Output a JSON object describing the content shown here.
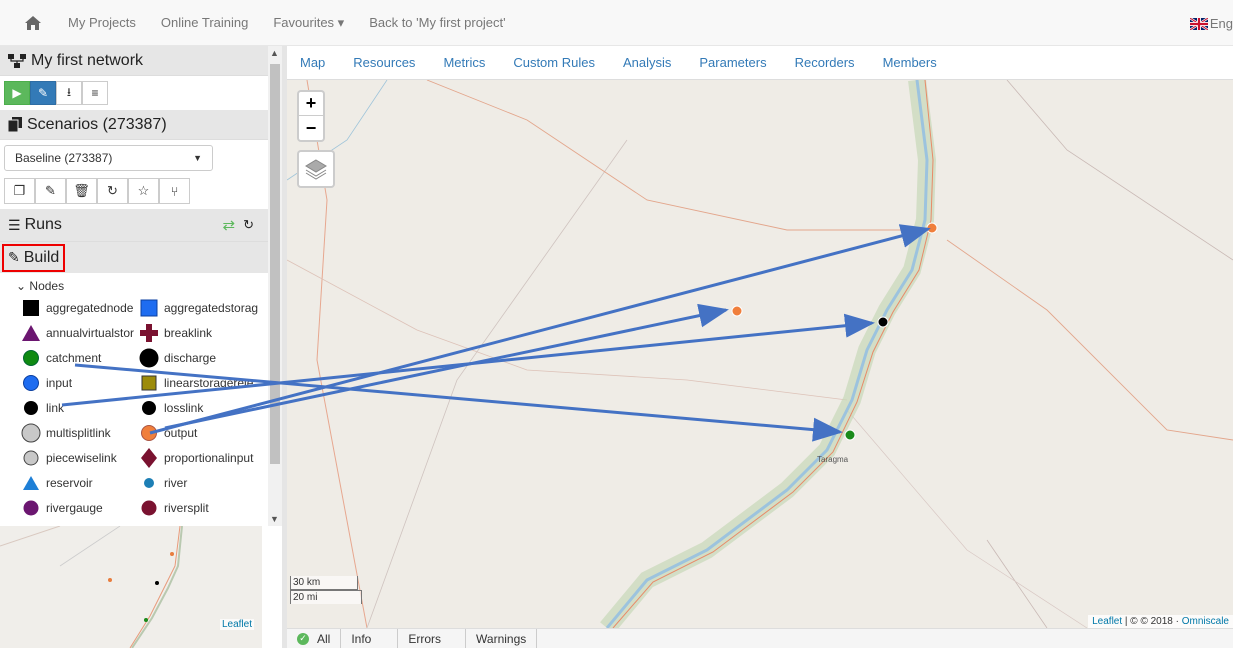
{
  "topnav": {
    "links": [
      "My Projects",
      "Online Training",
      "Favourites ▾",
      "Back to 'My first project'"
    ],
    "language": "Eng"
  },
  "network": {
    "title": "My first network",
    "buttons": [
      "run",
      "edit",
      "download",
      "settings"
    ]
  },
  "scenarios": {
    "title": "Scenarios (273387)",
    "selected": "Baseline (273387)",
    "buttons": [
      "copy",
      "edit",
      "delete",
      "refresh",
      "favourite",
      "branch"
    ]
  },
  "runs": {
    "title": "Runs"
  },
  "build": {
    "title": "Build",
    "nodes_title": "Nodes",
    "nodes": [
      {
        "label": "aggregatednode",
        "shape": "black-square"
      },
      {
        "label": "aggregatedstorag",
        "shape": "blue-square"
      },
      {
        "label": "annualvirtualstor",
        "shape": "purple-triangle"
      },
      {
        "label": "breaklink",
        "shape": "maroon-cross"
      },
      {
        "label": "catchment",
        "shape": "green-circle"
      },
      {
        "label": "discharge",
        "shape": "black-circle-large"
      },
      {
        "label": "input",
        "shape": "blue-circle"
      },
      {
        "label": "linearstoragerele",
        "shape": "olive-square"
      },
      {
        "label": "link",
        "shape": "black-circle"
      },
      {
        "label": "losslink",
        "shape": "black-circle"
      },
      {
        "label": "multisplitlink",
        "shape": "grey-circle-large"
      },
      {
        "label": "output",
        "shape": "orange-circle"
      },
      {
        "label": "piecewiselink",
        "shape": "grey-circle"
      },
      {
        "label": "proportionalinput",
        "shape": "maroon-diamond"
      },
      {
        "label": "reservoir",
        "shape": "blue-triangle"
      },
      {
        "label": "river",
        "shape": "teal-circle-small"
      },
      {
        "label": "rivergauge",
        "shape": "purple-circle"
      },
      {
        "label": "riversplit",
        "shape": "maroon-circle"
      }
    ]
  },
  "minimap": {
    "attribution": "Leaflet"
  },
  "tabs": [
    "Map",
    "Resources",
    "Metrics",
    "Custom Rules",
    "Analysis",
    "Parameters",
    "Recorders",
    "Members"
  ],
  "map": {
    "zoom_in": "+",
    "zoom_out": "−",
    "scale_km": "30 km",
    "scale_mi": "20 mi",
    "attribution_leaflet": "Leaflet",
    "attribution_rest": " | © © 2018 · ",
    "attribution_omniscale": "Omniscale",
    "place_taragma": "Taragma"
  },
  "statusbar": {
    "tabs": [
      "All",
      "Info",
      "Errors",
      "Warnings"
    ]
  },
  "colors": {
    "link": "#337ab7",
    "arrow": "#4472c4",
    "highlight": "#e00000"
  }
}
